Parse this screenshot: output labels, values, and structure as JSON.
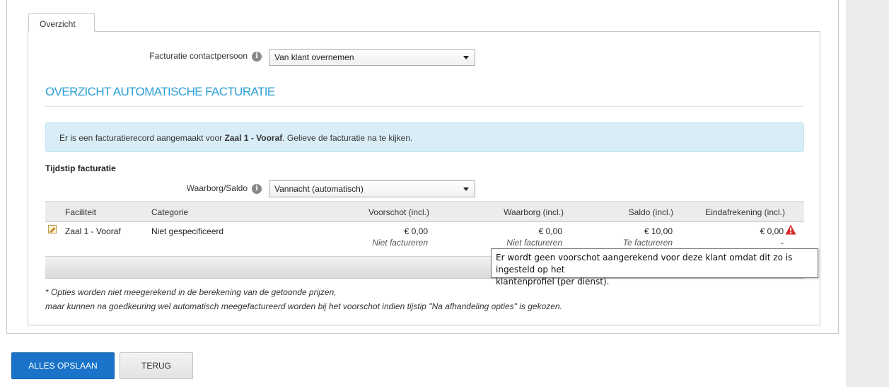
{
  "tabs": [
    {
      "label": "Overzicht"
    }
  ],
  "contact": {
    "label": "Facturatie contactpersoon",
    "selected": "Van klant overnemen"
  },
  "section": {
    "title": "OVERZICHT AUTOMATISCHE FACTURATIE"
  },
  "alert": {
    "text_before": "Er is een facturatierecord aangemaakt voor ",
    "bold": "Zaal 1 - Vooraf",
    "text_after": ". Gelieve de facturatie na te kijken."
  },
  "timing": {
    "heading": "Tijdstip facturatie",
    "label": "Waarborg/Saldo",
    "selected": "Vannacht (automatisch)"
  },
  "table": {
    "columns": [
      "Faciliteit",
      "Categorie",
      "Voorschot (incl.)",
      "Waarborg (incl.)",
      "Saldo (incl.)",
      "Eindafrekening (incl.)"
    ],
    "rows": [
      {
        "faciliteit": "Zaal 1 - Vooraf",
        "categorie": "Niet gespecificeerd",
        "voorschot": "€ 0,00",
        "voorschot_status": "Niet factureren",
        "waarborg": "€ 0,00",
        "waarborg_status": "Niet factureren",
        "saldo": "€ 10,00",
        "saldo_status": "Te factureren",
        "eindafrekening": "€ 0,00",
        "eindafrekening_status": "-"
      }
    ]
  },
  "tooltip": {
    "line1": "Er wordt geen voorschot aangerekend voor deze klant omdat dit zo is ingesteld op het",
    "line2": "klantenprofiel (per dienst)."
  },
  "footnote": {
    "line1": "* Opties worden niet meegerekend in de berekening van de getoonde prijzen,",
    "line2": "maar kunnen na goedkeuring wel automatisch meegefactureerd worden bij het voorschot indien tijstip \"Na afhandeling opties\" is gekozen."
  },
  "buttons": {
    "save": "ALLES OPSLAAN",
    "back": "TERUG"
  },
  "icons": {
    "info": "info-icon",
    "edit": "pencil-icon",
    "warning": "warning-icon",
    "caret": "chevron-down-icon"
  },
  "colors": {
    "accent": "#2a9fd6",
    "primary_button": "#1a73c8",
    "alert_bg": "#d9edf7",
    "warning": "#d9262a"
  }
}
